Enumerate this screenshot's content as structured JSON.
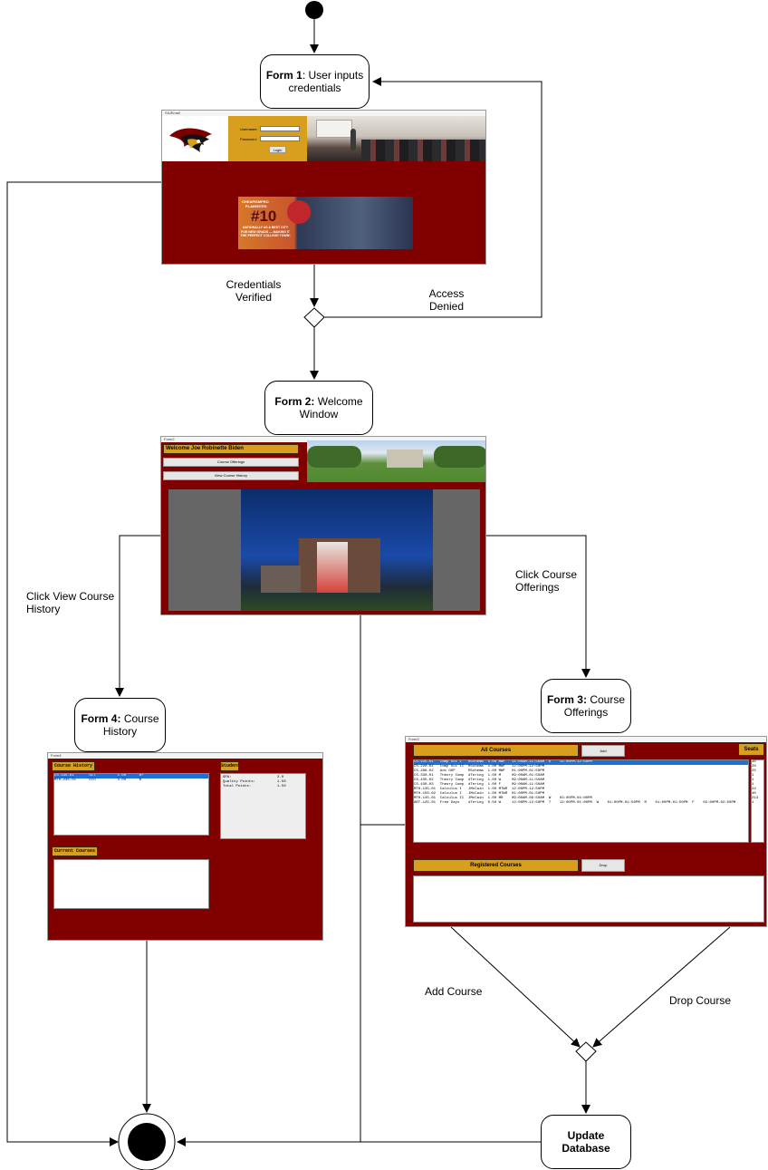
{
  "diagram": {
    "form1": {
      "bold": "Form 1",
      "rest": ": User inputs credentials"
    },
    "form2": {
      "bold": "Form 2:",
      "rest": " Welcome Window"
    },
    "form3": {
      "bold": "Form 3:",
      "rest": " Course Offerings"
    },
    "form4": {
      "bold": "Form 4:",
      "rest": " Course History"
    },
    "update": "Update Database",
    "edges": {
      "verified": "Credentials Verified",
      "denied": "Access Denied",
      "history": "Click View Course History",
      "offerings": "Click Course Offerings",
      "add": "Add Course",
      "drop": "Drop Course"
    }
  },
  "login_form": {
    "title": "SIUEmail",
    "username_label": "Username:",
    "password_label": "Password:",
    "login_button": "Login",
    "banner": {
      "line1": "CHEAPISMPRO",
      "line2": "PLAINSITES",
      "rank": "#10",
      "text": "NATIONALLY AS A BEST CITY FOR NEW GRADS — MAKING IT THE PERFECT COLLEGE TOWN!"
    }
  },
  "welcome_form": {
    "title": "Form2",
    "welcome": "Welcome Joe Robinette Biden",
    "btn_offerings": "Course Offerings",
    "btn_history": "View Course History"
  },
  "offerings_form": {
    "title": "Form3",
    "all_courses": "All Courses",
    "add": "Add",
    "seats": "Seats",
    "registered": "Registered Courses",
    "drop": "Drop",
    "rows": [
      "CS-135-01   Comp Sci I   R5chema  3.00 MWF   11:00AM-11:50AM  R    11:00PM-12:50PM",
      "CS-220-01   Comp Sci II  R5chema  1.00 MWF   12:00PM-12:50PM",
      "CS-288-02   Adv OOP      R5chema  1.00 MWF   01:00PM-01:50PM",
      "CS-330-01   Theory Comp  dTering  1.00 M     09:00AM-01:50AM",
      "CS-435-02   Theory Comp  dTering  1.00 W     09:00AM-11:50AM",
      "CS-430-03   Theory Comp  dTering  1.00 F     09:00AM-11:50AM",
      "MTH-135-01  Calculus I   JMcCain  1.00 MTWR  12:00PM-12:50PM",
      "MTH-150-02  Calculus I   JMcCain  1.00 MTWR  01:00PM-01:50PM",
      "MTH-145-01  Calculus II  JMcCain  1.00 MR    09:00AM-09:50AM  W    03:00PM-04:00PM",
      "ART-125-01  Free Days    dTering  0.50 W     12:00PM-12:50PM  T    12:00PM-01:00PM  W    01:00PM-01:50PM  R    01:00PM-01:50PM  F    02:00PM-02:50PM"
    ],
    "seats_values": [
      "30",
      "20",
      "25",
      "1",
      "1",
      "1",
      "24",
      "40",
      "213",
      "1"
    ]
  },
  "history_form": {
    "title": "Form4",
    "course_history": "Course History",
    "student": "Student",
    "current_courses": "Current Courses",
    "history_rows": [
      "CS-135-01       SCT          1.00      B+",
      "MTH-235-01      ECO          3.00      B"
    ],
    "stats": [
      [
        "GPA:",
        "2.0"
      ],
      [
        "Quality Points:",
        "1.50"
      ],
      [
        "Total Points:",
        "1.50"
      ]
    ]
  }
}
